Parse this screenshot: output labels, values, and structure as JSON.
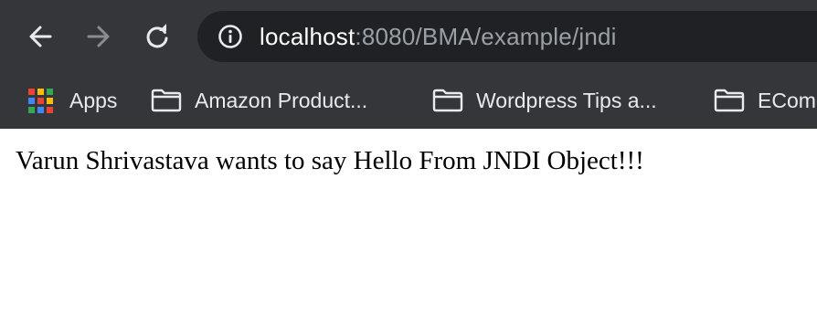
{
  "browser": {
    "address_bar": {
      "host": "localhost",
      "rest": ":8080/BMA/example/jndi"
    },
    "nav_icons": {
      "back": "back-arrow-icon",
      "forward": "forward-arrow-icon",
      "reload": "reload-icon",
      "site_info": "info-icon"
    },
    "bookmarks": [
      {
        "label": "Apps",
        "icon": "apps-grid-icon"
      },
      {
        "label": "Amazon Product...",
        "icon": "folder-icon"
      },
      {
        "label": "Wordpress Tips a...",
        "icon": "folder-icon"
      },
      {
        "label": "ECom",
        "icon": "folder-icon"
      }
    ],
    "colors": {
      "toolbar_bg": "#35363a",
      "omnibox_bg": "#202124",
      "url_host": "#ffffff",
      "url_rest": "#9aa0a6",
      "icon_active": "#e8eaed",
      "icon_disabled": "#8a8c90"
    }
  },
  "page": {
    "message": "Varun Shrivastava wants to say Hello From JNDI Object!!!"
  }
}
